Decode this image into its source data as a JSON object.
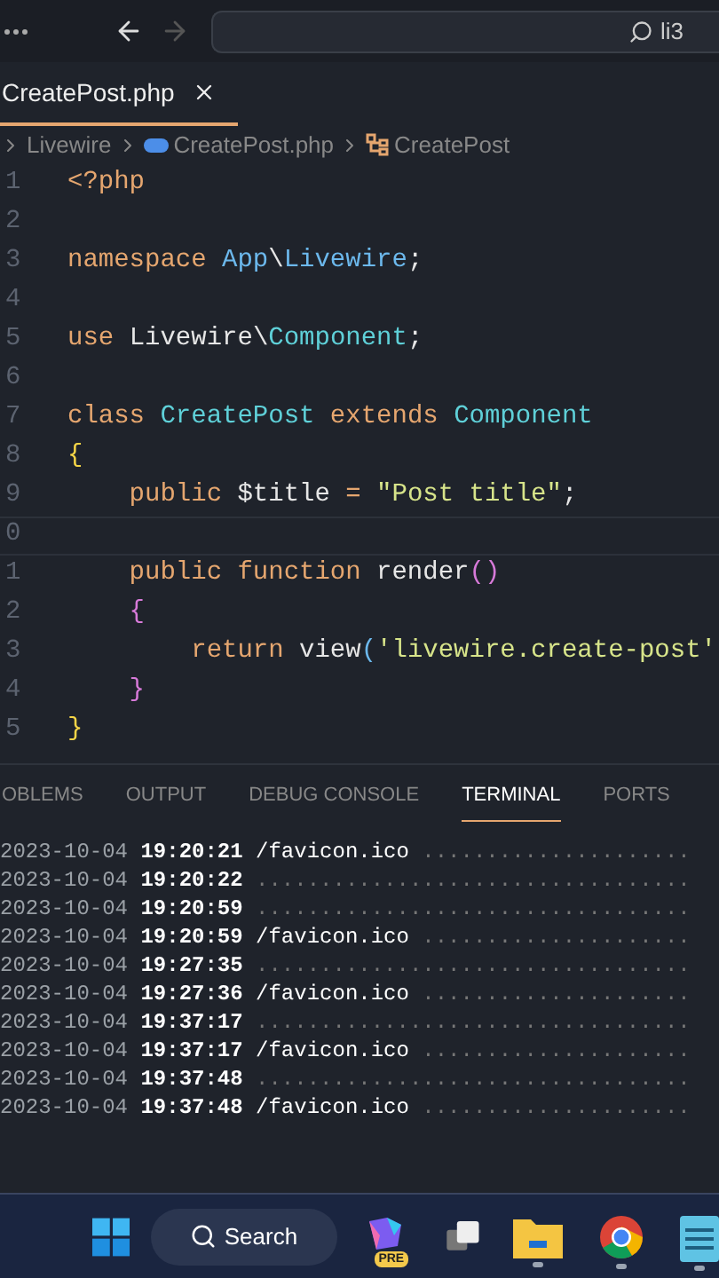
{
  "title_bar": {
    "back_enabled": true,
    "forward_enabled": false,
    "search": {
      "value": "li3"
    }
  },
  "tabs": [
    {
      "label": "CreatePost.php",
      "selected": true
    }
  ],
  "breadcrumb": [
    {
      "label": "Livewire",
      "kind": "folder"
    },
    {
      "label": "CreatePost.php",
      "kind": "file"
    },
    {
      "label": "CreatePost",
      "kind": "class"
    }
  ],
  "editor": {
    "lines": [
      {
        "number": "1",
        "tokens": [
          {
            "t": "<?php",
            "kind": "kw"
          }
        ]
      },
      {
        "number": "2"
      },
      {
        "number": "3",
        "tokens": [
          {
            "t": "namespace ",
            "kind": "kw"
          },
          {
            "t": "App",
            "kind": "ns"
          },
          {
            "t": "\\",
            "kind": "plain"
          },
          {
            "t": "Livewire",
            "kind": "ns"
          },
          {
            "t": ";",
            "kind": "plain"
          }
        ]
      },
      {
        "number": "4"
      },
      {
        "number": "5",
        "tokens": [
          {
            "t": "use ",
            "kind": "kw"
          },
          {
            "t": "Livewire",
            "kind": "plain"
          },
          {
            "t": "\\",
            "kind": "plain"
          },
          {
            "t": "Component",
            "kind": "cls"
          },
          {
            "t": ";",
            "kind": "plain"
          }
        ]
      },
      {
        "number": "6"
      },
      {
        "number": "7",
        "tokens": [
          {
            "t": "class ",
            "kind": "kw"
          },
          {
            "t": "CreatePost",
            "kind": "cls"
          },
          {
            "t": " extends ",
            "kind": "kw"
          },
          {
            "t": "Component",
            "kind": "cls"
          }
        ]
      },
      {
        "number": "8",
        "tokens": [
          {
            "t": "{",
            "kind": "brace"
          }
        ]
      },
      {
        "number": "9",
        "tokens": [
          {
            "t": "    public ",
            "kind": "kw"
          },
          {
            "t": "$title",
            "kind": "plain"
          },
          {
            "t": " = ",
            "kind": "kw"
          },
          {
            "t": "\"Post title\"",
            "kind": "str"
          },
          {
            "t": ";",
            "kind": "plain"
          }
        ]
      },
      {
        "number": "0",
        "current": true
      },
      {
        "number": "1",
        "tokens": [
          {
            "t": "    public function ",
            "kind": "kw"
          },
          {
            "t": "render",
            "kind": "plain"
          },
          {
            "t": "()",
            "kind": "paren"
          }
        ]
      },
      {
        "number": "2",
        "tokens": [
          {
            "t": "    {",
            "kind": "paren"
          }
        ]
      },
      {
        "number": "3",
        "tokens": [
          {
            "t": "        return ",
            "kind": "kw"
          },
          {
            "t": "view",
            "kind": "plain"
          },
          {
            "t": "(",
            "kind": "ns"
          },
          {
            "t": "'livewire.create-post'",
            "kind": "str"
          }
        ]
      },
      {
        "number": "4",
        "tokens": [
          {
            "t": "    }",
            "kind": "paren"
          }
        ]
      },
      {
        "number": "5",
        "tokens": [
          {
            "t": "}",
            "kind": "brace"
          }
        ]
      }
    ]
  },
  "panel_tabs": [
    {
      "label": "OBLEMS",
      "selected": false
    },
    {
      "label": "OUTPUT",
      "selected": false
    },
    {
      "label": "DEBUG CONSOLE",
      "selected": false
    },
    {
      "label": "TERMINAL",
      "selected": true
    },
    {
      "label": "PORTS",
      "selected": false
    }
  ],
  "terminal": [
    {
      "date": "2023-10-04",
      "time": "19:20:21",
      "path": "/favicon.ico",
      "dots": "....................."
    },
    {
      "date": "2023-10-04",
      "time": "19:20:22",
      "dots": ".................................."
    },
    {
      "date": "2023-10-04",
      "time": "19:20:59",
      "dots": ".................................."
    },
    {
      "date": "2023-10-04",
      "time": "19:20:59",
      "path": "/favicon.ico",
      "dots": "....................."
    },
    {
      "date": "2023-10-04",
      "time": "19:27:35",
      "dots": ".................................."
    },
    {
      "date": "2023-10-04",
      "time": "19:27:36",
      "path": "/favicon.ico",
      "dots": "....................."
    },
    {
      "date": "2023-10-04",
      "time": "19:37:17",
      "dots": ".................................."
    },
    {
      "date": "2023-10-04",
      "time": "19:37:17",
      "path": "/favicon.ico",
      "dots": "....................."
    },
    {
      "date": "2023-10-04",
      "time": "19:37:48",
      "dots": ".................................."
    },
    {
      "date": "2023-10-04",
      "time": "19:37:48",
      "path": "/favicon.ico",
      "dots": "....................."
    }
  ],
  "taskbar": {
    "search_label": "Search",
    "copilot_badge": "PRE",
    "apps": [
      {
        "kind": "start"
      },
      {
        "kind": "search"
      },
      {
        "kind": "copilot"
      },
      {
        "kind": "taskview"
      },
      {
        "kind": "files",
        "running": true
      },
      {
        "kind": "chrome",
        "running": true
      },
      {
        "kind": "notepad",
        "running": true
      }
    ]
  }
}
